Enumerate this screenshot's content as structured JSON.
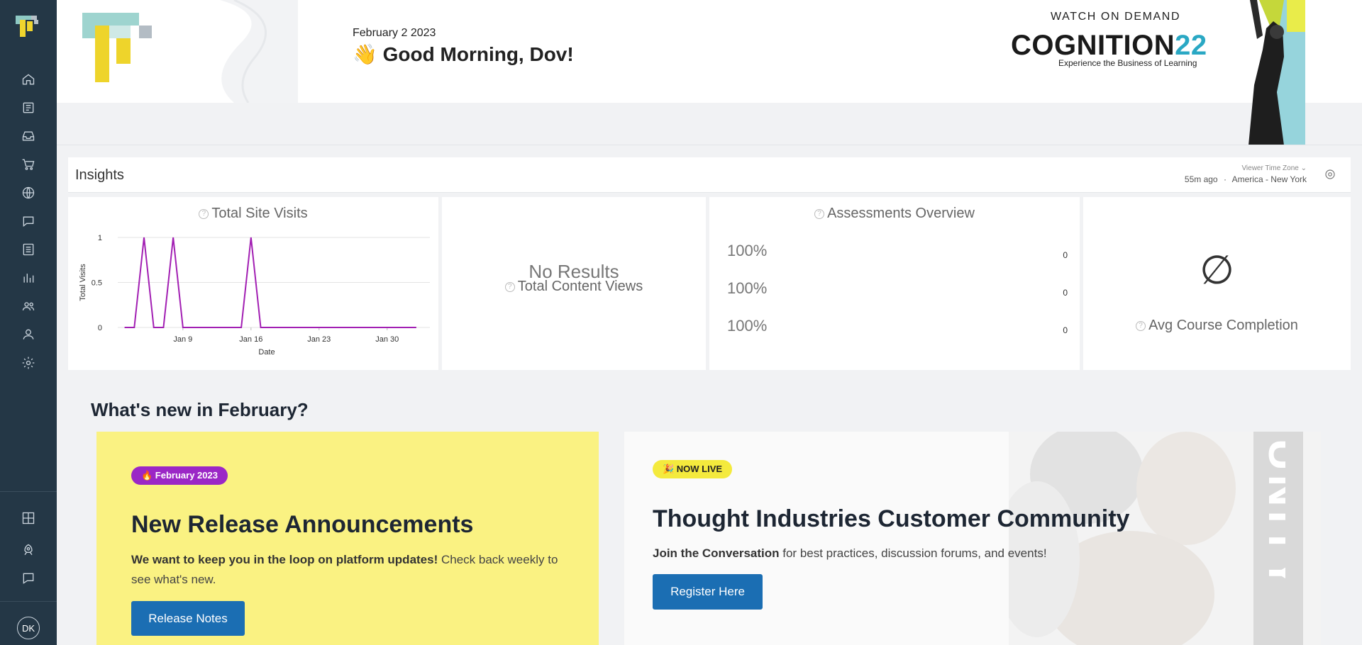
{
  "sidebar": {
    "nav": [
      {
        "name": "home-icon"
      },
      {
        "name": "content-icon"
      },
      {
        "name": "inbox-icon"
      },
      {
        "name": "cart-icon"
      },
      {
        "name": "globe-icon"
      },
      {
        "name": "chat-icon"
      },
      {
        "name": "list-icon"
      },
      {
        "name": "bar-chart-icon"
      },
      {
        "name": "users-icon"
      },
      {
        "name": "user-icon"
      },
      {
        "name": "gear-icon"
      }
    ],
    "bottom": [
      {
        "name": "grid-icon"
      },
      {
        "name": "rocket-icon"
      },
      {
        "name": "support-chat-icon"
      }
    ],
    "avatar_initials": "DK"
  },
  "header": {
    "date": "February 2 2023",
    "greeting": "👋 Good Morning, Dov!",
    "promo": {
      "watch": "WATCH ON DEMAND",
      "brand_text": "COGNITION",
      "brand_num": "22",
      "tagline": "Experience the Business of Learning"
    }
  },
  "insights": {
    "title": "Insights",
    "timezone_label": "Viewer Time Zone ⌄",
    "updated": "55m ago",
    "separator": "·",
    "timezone": "America - New York"
  },
  "cards": {
    "site_visits": {
      "title": "Total Site Visits",
      "chart_data": {
        "type": "line",
        "title": "Total Site Visits",
        "xlabel": "Date",
        "ylabel": "Total Visits",
        "ylim": [
          0,
          1
        ],
        "yticks": [
          "0",
          "0.5",
          "1"
        ],
        "xticks": [
          "Jan 9",
          "Jan 16",
          "Jan 23",
          "Jan 30"
        ],
        "series": [
          {
            "color": "#a21fb3",
            "x": [
              "Jan 3",
              "Jan 4",
              "Jan 5",
              "Jan 6",
              "Jan 7",
              "Jan 8",
              "Jan 9",
              "Jan 10",
              "Jan 11",
              "Jan 12",
              "Jan 13",
              "Jan 14",
              "Jan 15",
              "Jan 16",
              "Jan 17",
              "Jan 18",
              "Jan 19",
              "Jan 20",
              "Jan 21",
              "Jan 22",
              "Jan 23",
              "Jan 24",
              "Jan 25",
              "Jan 26",
              "Jan 27",
              "Jan 28",
              "Jan 29",
              "Jan 30",
              "Jan 31",
              "Feb 1",
              "Feb 2"
            ],
            "values": [
              0,
              0,
              1,
              0,
              0,
              1,
              0,
              0,
              0,
              0,
              0,
              0,
              0,
              1,
              0,
              0,
              0,
              0,
              0,
              0,
              0,
              0,
              0,
              0,
              0,
              0,
              0,
              0,
              0,
              0,
              0
            ]
          }
        ]
      }
    },
    "content_views": {
      "no_results": "No Results",
      "title": "Total Content Views"
    },
    "assessments": {
      "title": "Assessments Overview",
      "rows": [
        {
          "pct": "100%",
          "value": "0"
        },
        {
          "pct": "100%",
          "value": "0"
        },
        {
          "pct": "100%",
          "value": "0"
        }
      ]
    },
    "completion": {
      "symbol": "∅",
      "title": "Avg Course Completion"
    }
  },
  "whats_new": {
    "heading": "What's new in February?",
    "release": {
      "badge": "🔥 February 2023",
      "title": "New Release Announcements",
      "bold_text": "We want to keep you in the loop on platform updates!",
      "text": " Check back weekly to see what's new.",
      "button": "Release Notes"
    },
    "community": {
      "badge": "🎉 NOW LIVE",
      "title": "Thought Industries Customer Community",
      "bold_text": "Join the Conversation",
      "text": " for best practices, discussion forums, and events!",
      "button": "Register Here",
      "vertical_text": "UNITY"
    }
  },
  "colors": {
    "sidebar": "#243746",
    "accent_blue": "#1b6eb3",
    "panel_yellow": "#faf282",
    "purple": "#9b27c6",
    "chart_line": "#a21fb3"
  }
}
